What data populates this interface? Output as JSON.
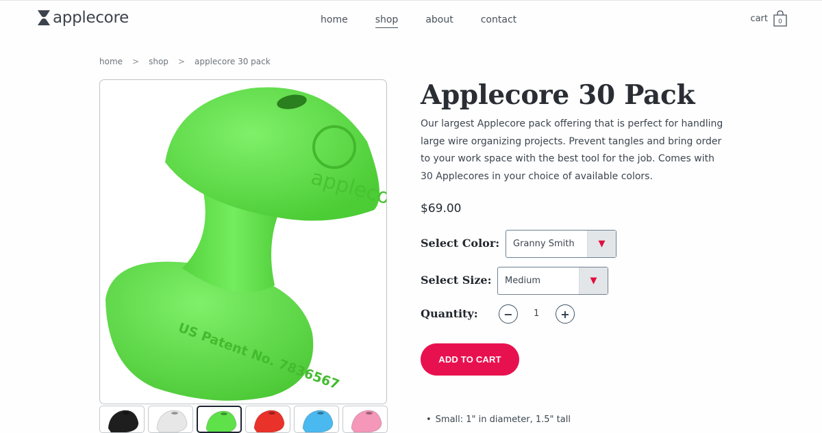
{
  "header": {
    "logo_text": "applecore",
    "nav": [
      "home",
      "shop",
      "about",
      "contact"
    ],
    "active_nav": "shop",
    "cart_label": "cart",
    "cart_count": "0"
  },
  "breadcrumb": [
    "home",
    ">",
    "shop",
    ">",
    "applecore 30 pack"
  ],
  "product": {
    "title": "Applecore 30 Pack",
    "description": "Our largest Applecore pack offering that is perfect for handling large wire organizing projects. Prevent tangles and bring order to your work space with the best tool for the job. Comes with 30 Applecores in your choice of available colors.",
    "price": "$69.00",
    "color_label": "Select Color:",
    "color_value": "Granny Smith",
    "size_label": "Select Size:",
    "size_value": "Medium",
    "quantity_label": "Quantity:",
    "quantity_value": "1",
    "add_to_cart": "ADD TO CART",
    "specs": [
      "Small: 1\" in diameter, 1.5\" tall"
    ],
    "image_text": {
      "brand": "applecore",
      "patent": "US Patent No. 7836567"
    }
  },
  "thumbnails": [
    {
      "name": "black",
      "color": "#1e1e1e"
    },
    {
      "name": "white",
      "color": "#e7e7e7"
    },
    {
      "name": "green",
      "color": "#5fe14a"
    },
    {
      "name": "red",
      "color": "#e9322a"
    },
    {
      "name": "blue",
      "color": "#4ab9ef"
    },
    {
      "name": "pink",
      "color": "#f497b9"
    }
  ],
  "colors": {
    "accent": "#e8114f",
    "product_green": "#62e34a"
  }
}
